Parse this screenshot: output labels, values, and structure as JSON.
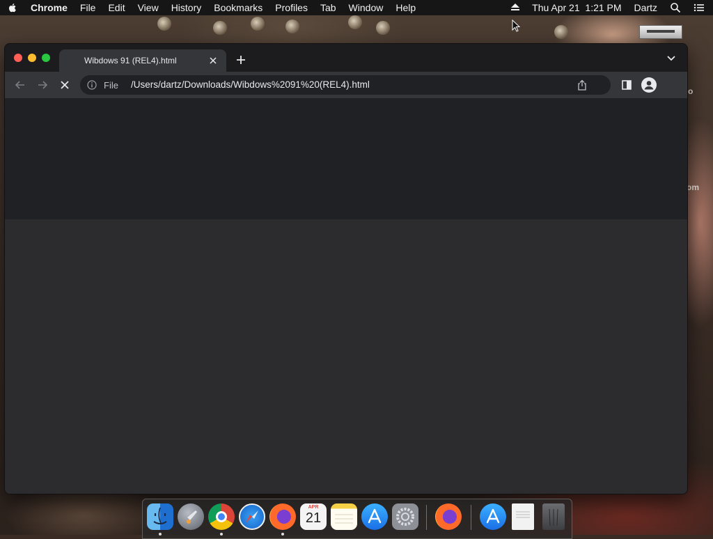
{
  "menubar": {
    "apple": "apple-icon",
    "app_name": "Chrome",
    "items": [
      "File",
      "Edit",
      "View",
      "History",
      "Bookmarks",
      "Profiles",
      "Tab",
      "Window",
      "Help"
    ],
    "datetime": "Thu Apr 21  1:21 PM",
    "user": "Dartz"
  },
  "browser": {
    "tab_title": "Wibdows 91 (REL4).html",
    "omnibox": {
      "scheme_label": "File",
      "url": "/Users/dartz/Downloads/Wibdows%2091%20(REL4).html"
    }
  },
  "dock": {
    "apps": [
      "Finder",
      "Launchpad",
      "Google Chrome",
      "Safari",
      "Firefox",
      "Calendar",
      "Notes",
      "App Store",
      "System Preferences",
      "Firefox",
      "App Store Downloads",
      "Document",
      "Trash"
    ],
    "calendar_month": "APR",
    "calendar_day": "21"
  },
  "wallpaper": {
    "partial_text_1": "o",
    "partial_text_2": "om"
  },
  "colors": {
    "menubar_bg": "#161616",
    "tabstrip_bg": "#1c1c1e",
    "toolbar_bg": "#35363a",
    "omnibox_bg": "#202124",
    "content_bg": "#2c2c2e"
  }
}
